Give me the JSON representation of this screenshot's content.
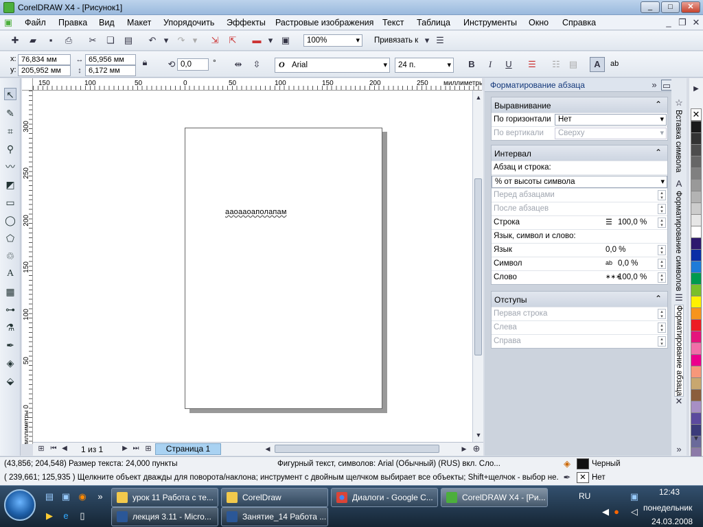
{
  "window": {
    "title": "CorelDRAW X4 - [Рисунок1]",
    "min": "_",
    "max": "□",
    "close": "✕"
  },
  "menu": [
    "Файл",
    "Правка",
    "Вид",
    "Макет",
    "Упорядочить",
    "Эффекты",
    "Растровые изображения",
    "Текст",
    "Таблица",
    "Инструменты",
    "Окно",
    "Справка"
  ],
  "toolbar1": {
    "zoom": "100%",
    "snap": "Привязать к"
  },
  "toolbar2": {
    "x": "76,834 мм",
    "y": "205,952 мм",
    "w": "65,956 мм",
    "h": "6,172 мм",
    "x_label": "x:",
    "y_label": "y:",
    "angle": "0,0",
    "deg": "°",
    "font": "Arial",
    "font_icon": "O",
    "size": "24 п.",
    "bold": "B",
    "italic": "I",
    "underline": "U",
    "text_tool": "ab"
  },
  "ruler": {
    "h_ticks": [
      "150",
      "100",
      "50",
      "0",
      "50",
      "100",
      "150",
      "200",
      "250"
    ],
    "unit": "миллиметры",
    "v_ticks": [
      "300",
      "250",
      "200",
      "150",
      "100",
      "50",
      "0"
    ],
    "v_unit": "миллиметры"
  },
  "canvas": {
    "text": "ааоааоаполапам"
  },
  "pager": {
    "count": "1 из 1",
    "tab": "Страница 1"
  },
  "docker": {
    "title": "Форматирование абзаца",
    "align": {
      "header": "Выравнивание",
      "h_label": "По горизонтали",
      "h_value": "Нет",
      "v_label": "По вертикали",
      "v_value": "Сверху"
    },
    "interval": {
      "header": "Интервал",
      "para_line": "Абзац и строка:",
      "mode": "% от высоты символа",
      "before": "Перед абзацами",
      "after": "После абзацев",
      "line": "Строка",
      "line_value": "100,0 %",
      "lang_sym_word": "Язык, символ и слово:",
      "lang": "Язык",
      "lang_value": "0,0 %",
      "sym": "Символ",
      "sym_value": "0,0 %",
      "word": "Слово",
      "word_value": "100,0 %"
    },
    "indents": {
      "header": "Отступы",
      "first": "Первая строка",
      "left": "Слева",
      "right": "Справа"
    }
  },
  "side_tabs": [
    "Вставка символа",
    "Форматирование символов",
    "Форматирование абзаца"
  ],
  "palette": [
    "#ffffff",
    "#1a1a1a",
    "#333333",
    "#4d4d4d",
    "#666666",
    "#808080",
    "#999999",
    "#b3b3b3",
    "#cccccc",
    "#e6e6e6",
    "#ffffff",
    "#2e1a6e",
    "#0a2ea6",
    "#1e7bd8",
    "#009a4e",
    "#7bbf2a",
    "#fff200",
    "#f7941d",
    "#ed1c24",
    "#e4147c",
    "#f16ea8",
    "#ec008c",
    "#f7977a",
    "#c8a76f",
    "#8b5e3c",
    "#a78fc4",
    "#5c4a9e",
    "#3b3b7a",
    "#6a6a9a",
    "#8c7aa8"
  ],
  "status": {
    "line1_left": "(43,856; 204,548)  Размер текста: 24,000 пункты",
    "line1_mid": "Фигурный текст, символов: Arial (Обычный) (RUS) вкл. Сло...",
    "line1_fill": "Черный",
    "line2_left": "( 239,661; 125,935 )   Щелкните объект дважды для поворота/наклона; инструмент с двойным щелчком выбирает все объекты; Shift+щелчок - выбор не...",
    "line2_outline": "Нет"
  },
  "taskbar": {
    "row1": [
      "урок 11 Работа с те...",
      "CorelDraw",
      "Диалоги - Google C...",
      "CorelDRAW X4 - [Ри..."
    ],
    "row2": [
      "лекция 3.11 - Micro...",
      "Занятие_14 Работа ..."
    ],
    "lang": "RU",
    "time": "12:43",
    "day": "понедельник",
    "date": "24.03.2008"
  }
}
